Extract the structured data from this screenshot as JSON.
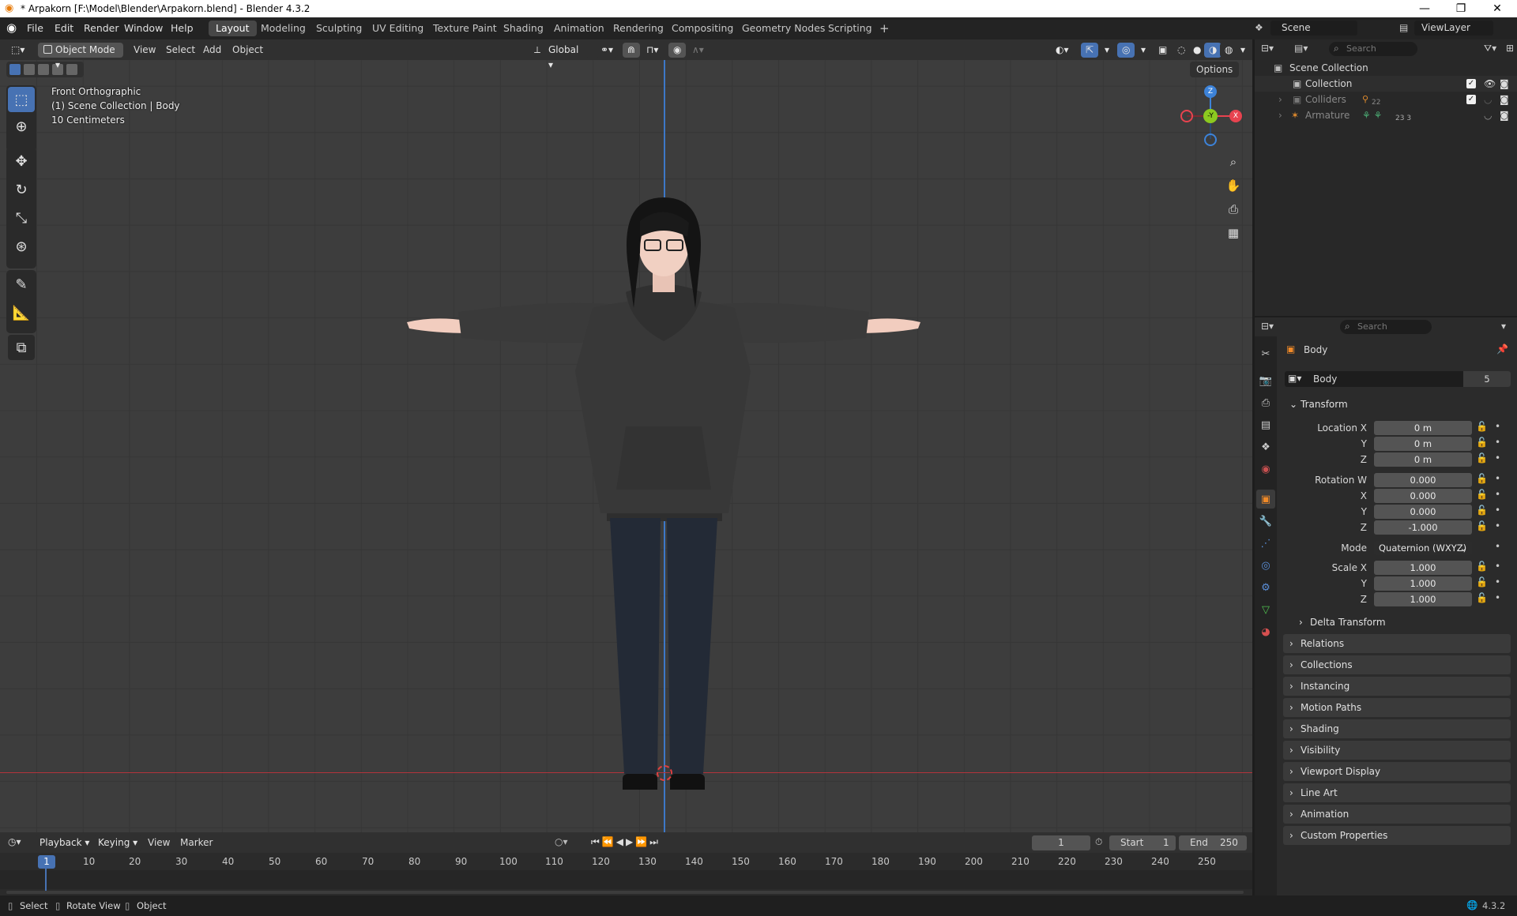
{
  "window": {
    "title": "* Arpakorn [F:\\Model\\Blender\\Arpakorn.blend] - Blender 4.3.2",
    "minimize": "—",
    "maximize": "❐",
    "close": "✕"
  },
  "menu": [
    "File",
    "Edit",
    "Render",
    "Window",
    "Help"
  ],
  "workspaces": [
    "Layout",
    "Modeling",
    "Sculpting",
    "UV Editing",
    "Texture Paint",
    "Shading",
    "Animation",
    "Rendering",
    "Compositing",
    "Geometry Nodes",
    "Scripting"
  ],
  "active_workspace": "Layout",
  "add_workspace": "+",
  "scene": {
    "name": "Scene",
    "view_layer": "ViewLayer"
  },
  "viewport": {
    "mode": "Object Mode",
    "menus": [
      "View",
      "Select",
      "Add",
      "Object"
    ],
    "transform_orientation": "Global",
    "options": "Options",
    "view_name": "Front Orthographic",
    "collection_info": "(1) Scene Collection | Body",
    "scale_info": "10 Centimeters",
    "gizmo": {
      "z": "Z",
      "y": "-Y",
      "x": "X"
    }
  },
  "outliner": {
    "search_placeholder": "Search",
    "items": [
      {
        "label": "Scene Collection",
        "extra": ""
      },
      {
        "label": "Collection",
        "extra": ""
      },
      {
        "label": "Colliders",
        "extra": "22"
      },
      {
        "label": "Armature",
        "extra": "23  3"
      }
    ]
  },
  "properties": {
    "search_placeholder": "Search",
    "object_name": "Body",
    "datablock": "Body",
    "users": "5",
    "transform_header": "Transform",
    "location": {
      "label": "Location X",
      "x": "0 m",
      "y": "0 m",
      "z": "0 m"
    },
    "rotation": {
      "label": "Rotation W",
      "w": "0.000",
      "x": "0.000",
      "y": "0.000",
      "z": "-1.000"
    },
    "axis": {
      "x": "X",
      "y": "Y",
      "z": "Z"
    },
    "mode_label": "Mode",
    "mode_value": "Quaternion (WXYZ)",
    "scale": {
      "label": "Scale X",
      "x": "1.000",
      "y": "1.000",
      "z": "1.000"
    },
    "delta_transform": "Delta Transform",
    "panels": [
      "Relations",
      "Collections",
      "Instancing",
      "Motion Paths",
      "Shading",
      "Visibility",
      "Viewport Display",
      "Line Art",
      "Animation",
      "Custom Properties"
    ]
  },
  "timeline": {
    "menus": [
      "Playback",
      "Keying",
      "View",
      "Marker"
    ],
    "current_frame": "1",
    "start_label": "Start",
    "start": "1",
    "end_label": "End",
    "end": "250",
    "frames": [
      "1",
      "10",
      "20",
      "30",
      "40",
      "50",
      "60",
      "70",
      "80",
      "90",
      "100",
      "110",
      "120",
      "130",
      "140",
      "150",
      "160",
      "170",
      "180",
      "190",
      "200",
      "210",
      "220",
      "230",
      "240",
      "250"
    ]
  },
  "status": {
    "items": [
      "Select",
      "Rotate View",
      "Object"
    ],
    "version": "4.3.2"
  },
  "colors": {
    "accent": "#4772b3",
    "x_axis": "#e8434f",
    "y_axis": "#8cc920",
    "z_axis": "#3d83d9",
    "object_orange": "#f08a28"
  }
}
